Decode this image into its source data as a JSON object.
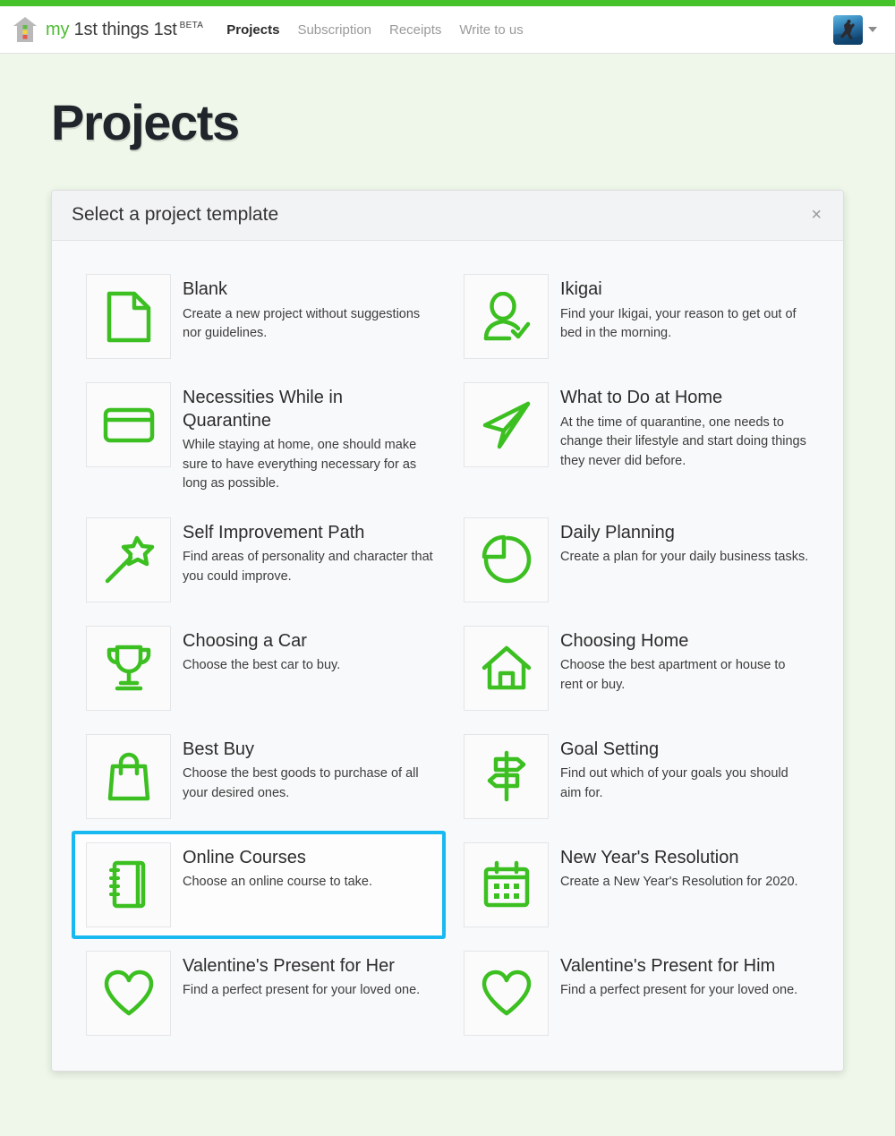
{
  "brand": {
    "logo_icon": "house-logo-icon",
    "word_my": "my",
    "word_rest": " 1st things 1st",
    "beta": "BETA"
  },
  "nav": {
    "links": [
      {
        "label": "Projects",
        "active": true
      },
      {
        "label": "Subscription",
        "active": false
      },
      {
        "label": "Receipts",
        "active": false
      },
      {
        "label": "Write to us",
        "active": false
      }
    ],
    "avatar_icon": "user-avatar",
    "caret_icon": "chevron-down-icon"
  },
  "page": {
    "title": "Projects"
  },
  "modal": {
    "title": "Select a project template",
    "close_label": "×"
  },
  "colors": {
    "brand_green": "#45c12a",
    "icon_green": "#3cbf20",
    "highlight_blue": "#18b9f0",
    "page_bg": "#eef7ea",
    "panel_bg": "#f8f9fa"
  },
  "templates": [
    {
      "name": "Blank",
      "desc": "Create a new project without suggestions nor guidelines.",
      "icon": "document-icon",
      "highlighted": false
    },
    {
      "name": "Ikigai",
      "desc": "Find your Ikigai, your reason to get out of bed in the morning.",
      "icon": "person-check-icon",
      "highlighted": false
    },
    {
      "name": "Necessities While in Quarantine",
      "desc": "While staying at home, one should make sure to have everything necessary for as long as possible.",
      "icon": "credit-card-icon",
      "highlighted": false
    },
    {
      "name": "What to Do at Home",
      "desc": "At the time of quarantine, one needs to change their lifestyle and start doing things they never did before.",
      "icon": "paper-plane-icon",
      "highlighted": false
    },
    {
      "name": "Self Improvement Path",
      "desc": "Find areas of personality and character that you could improve.",
      "icon": "magic-wand-icon",
      "highlighted": false
    },
    {
      "name": "Daily Planning",
      "desc": "Create a plan for your daily business tasks.",
      "icon": "pie-chart-icon",
      "highlighted": false
    },
    {
      "name": "Choosing a Car",
      "desc": "Choose the best car to buy.",
      "icon": "trophy-icon",
      "highlighted": false
    },
    {
      "name": "Choosing Home",
      "desc": "Choose the best apartment or house to rent or buy.",
      "icon": "home-icon",
      "highlighted": false
    },
    {
      "name": "Best Buy",
      "desc": "Choose the best goods to purchase of all your desired ones.",
      "icon": "shopping-bag-icon",
      "highlighted": false
    },
    {
      "name": "Goal Setting",
      "desc": "Find out which of your goals you should aim for.",
      "icon": "signpost-icon",
      "highlighted": false
    },
    {
      "name": "Online Courses",
      "desc": "Choose an online course to take.",
      "icon": "notebook-icon",
      "highlighted": true
    },
    {
      "name": "New Year's Resolution",
      "desc": "Create a New Year's Resolution for 2020.",
      "icon": "calendar-icon",
      "highlighted": false
    },
    {
      "name": "Valentine's Present for Her",
      "desc": "Find a perfect present for your loved one.",
      "icon": "heart-icon",
      "highlighted": false
    },
    {
      "name": "Valentine's Present for Him",
      "desc": "Find a perfect present for your loved one.",
      "icon": "heart-icon",
      "highlighted": false
    }
  ]
}
